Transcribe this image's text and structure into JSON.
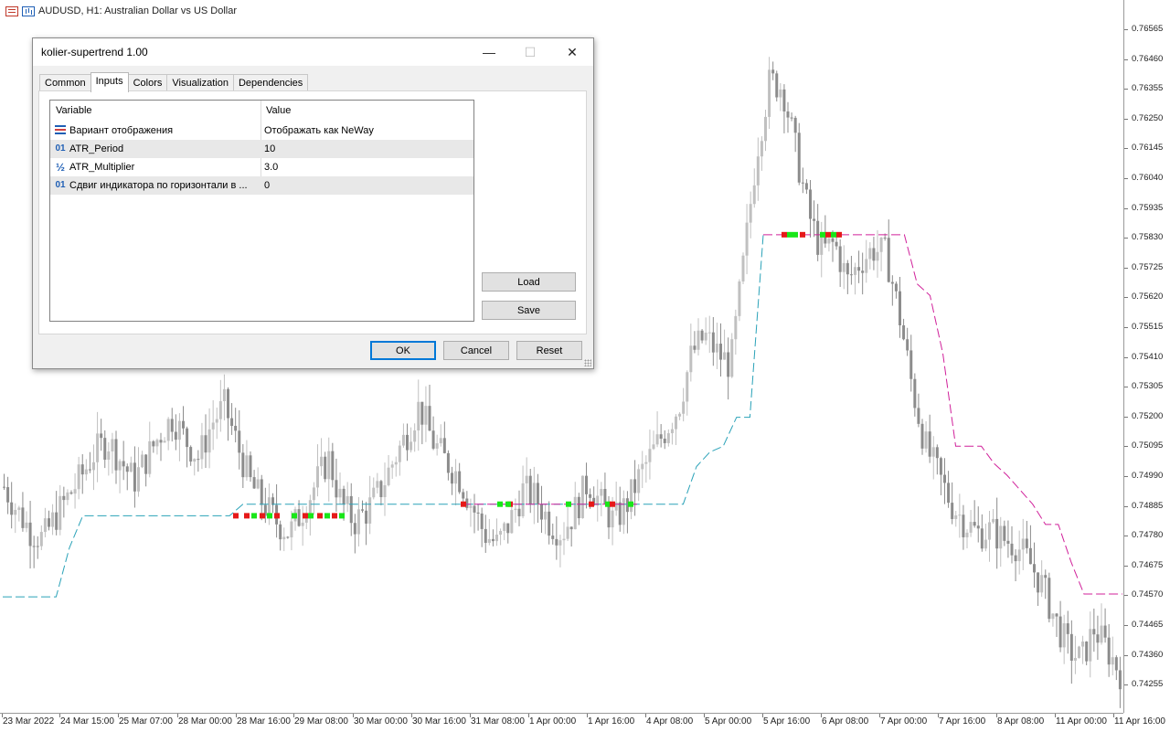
{
  "chart": {
    "title": "AUDUSD, H1:  Australian Dollar vs US Dollar",
    "symbol_icon": "bars-icon",
    "chart_icon": "candles-icon",
    "price_labels": [
      "0.76565",
      "0.76460",
      "0.76355",
      "0.76250",
      "0.76145",
      "0.76040",
      "0.75935",
      "0.75830",
      "0.75725",
      "0.75620",
      "0.75515",
      "0.75410",
      "0.75305",
      "0.75200",
      "0.75095",
      "0.74990",
      "0.74885",
      "0.74780",
      "0.74675",
      "0.74570",
      "0.74465",
      "0.74360",
      "0.74255"
    ],
    "time_labels": [
      "23 Mar 2022",
      "24 Mar 15:00",
      "25 Mar 07:00",
      "28 Mar 00:00",
      "28 Mar 16:00",
      "29 Mar 08:00",
      "30 Mar 00:00",
      "30 Mar 16:00",
      "31 Mar 08:00",
      "1 Apr 00:00",
      "1 Apr 16:00",
      "4 Apr 08:00",
      "5 Apr 00:00",
      "5 Apr 16:00",
      "6 Apr 08:00",
      "7 Apr 00:00",
      "7 Apr 16:00",
      "8 Apr 08:00",
      "11 Apr 00:00",
      "11 Apr 16:00"
    ],
    "colors": {
      "candle": "#8c8c8c",
      "candle_light": "#c0c0c0",
      "supertrend_up": "#2aa2b8",
      "supertrend_down": "#d0209a",
      "signal_buy": "#19e619",
      "signal_sell": "#e61919"
    }
  },
  "chart_data": {
    "type": "candlestick",
    "title": "AUDUSD, H1:  Australian Dollar vs US Dollar",
    "ylim": [
      0.7418,
      0.7664
    ],
    "x_labels": [
      "23 Mar 2022",
      "24 Mar 15:00",
      "25 Mar 07:00",
      "28 Mar 00:00",
      "28 Mar 16:00",
      "29 Mar 08:00",
      "30 Mar 00:00",
      "30 Mar 16:00",
      "31 Mar 08:00",
      "1 Apr 00:00",
      "1 Apr 16:00",
      "4 Apr 08:00",
      "5 Apr 00:00",
      "5 Apr 16:00",
      "6 Apr 08:00",
      "7 Apr 00:00",
      "7 Apr 16:00",
      "8 Apr 08:00",
      "11 Apr 00:00",
      "11 Apr 16:00"
    ],
    "close_path": [
      0.7496,
      0.7488,
      0.7481,
      0.7478,
      0.7486,
      0.7493,
      0.75,
      0.7508,
      0.7512,
      0.7505,
      0.7498,
      0.7506,
      0.7514,
      0.752,
      0.7512,
      0.7506,
      0.7518,
      0.7524,
      0.751,
      0.7497,
      0.749,
      0.7484,
      0.748,
      0.7488,
      0.7497,
      0.7506,
      0.749,
      0.7484,
      0.7488,
      0.7495,
      0.7505,
      0.7514,
      0.7524,
      0.7512,
      0.7505,
      0.75,
      0.749,
      0.748,
      0.7476,
      0.7484,
      0.7495,
      0.7492,
      0.7484,
      0.748,
      0.7488,
      0.7498,
      0.749,
      0.7484,
      0.749,
      0.75,
      0.7508,
      0.7516,
      0.7524,
      0.7542,
      0.7548,
      0.7542,
      0.7538,
      0.7574,
      0.7612,
      0.7636,
      0.7634,
      0.7612,
      0.759,
      0.7577,
      0.758,
      0.7567,
      0.7574,
      0.7578,
      0.7576,
      0.7555,
      0.753,
      0.751,
      0.75,
      0.749,
      0.7484,
      0.748,
      0.7481,
      0.7478,
      0.7476,
      0.747,
      0.7462,
      0.745,
      0.744,
      0.7436,
      0.7447,
      0.744,
      0.7432
    ],
    "series": [
      {
        "name": "",
        "type": "supertrend-up",
        "values": [
          0.7458,
          0.7458,
          0.7458,
          0.7458,
          0.7458,
          0.7475,
          0.7486,
          0.7486,
          0.7486,
          0.7486,
          0.7486,
          0.7486,
          0.7486,
          0.7486,
          0.7486,
          0.7486,
          0.7486,
          0.7486,
          0.749,
          0.749,
          0.749,
          0.749,
          0.749,
          0.749,
          0.749,
          0.749,
          0.749,
          0.749,
          0.749,
          0.749,
          0.749,
          0.749,
          0.749,
          0.749,
          0.749,
          0.749,
          0.749,
          0.749,
          0.749,
          0.749,
          0.749,
          0.749,
          0.749,
          0.749,
          0.749,
          0.749,
          0.749,
          0.749,
          0.749,
          0.749,
          0.749,
          0.749,
          0.7503,
          0.7508,
          0.751,
          0.752,
          0.752,
          0.7583
        ]
      },
      {
        "name": "",
        "type": "supertrend-down",
        "values": [
          0.7583,
          0.7583,
          0.7583,
          0.7583,
          0.7583,
          0.7583,
          0.7583,
          0.7583,
          0.7583,
          0.7583,
          0.7583,
          0.7583,
          0.7566,
          0.7562,
          0.7542,
          0.751,
          0.751,
          0.751,
          0.7504,
          0.75,
          0.7495,
          0.749,
          0.7483,
          0.7483,
          0.747,
          0.7459,
          0.7459,
          0.7459,
          0.7459
        ]
      }
    ],
    "signals": {
      "buy_count": 18,
      "sell_count": 12
    }
  },
  "dialog": {
    "title": "kolier-supertrend 1.00",
    "controls": {
      "minimize": "—",
      "maximize": "☐",
      "close": "✕"
    },
    "tabs": [
      {
        "label": "Common"
      },
      {
        "label": "Inputs"
      },
      {
        "label": "Colors"
      },
      {
        "label": "Visualization"
      },
      {
        "label": "Dependencies"
      }
    ],
    "active_tab": "Inputs",
    "grid": {
      "header": {
        "variable": "Variable",
        "value": "Value"
      },
      "rows": [
        {
          "icon": "enum-icon",
          "icon_text": "",
          "variable": "Вариант отображения",
          "value": "Отображать как NeWay"
        },
        {
          "icon": "int-icon",
          "icon_text": "01",
          "variable": "ATR_Period",
          "value": "10"
        },
        {
          "icon": "double-icon",
          "icon_text": "½",
          "variable": "ATR_Multiplier",
          "value": "3.0"
        },
        {
          "icon": "int-icon",
          "icon_text": "01",
          "variable": "Сдвиг индикатора по горизонтали в ...",
          "value": "0"
        }
      ]
    },
    "buttons": {
      "load": "Load",
      "save": "Save",
      "ok": "OK",
      "cancel": "Cancel",
      "reset": "Reset"
    }
  }
}
